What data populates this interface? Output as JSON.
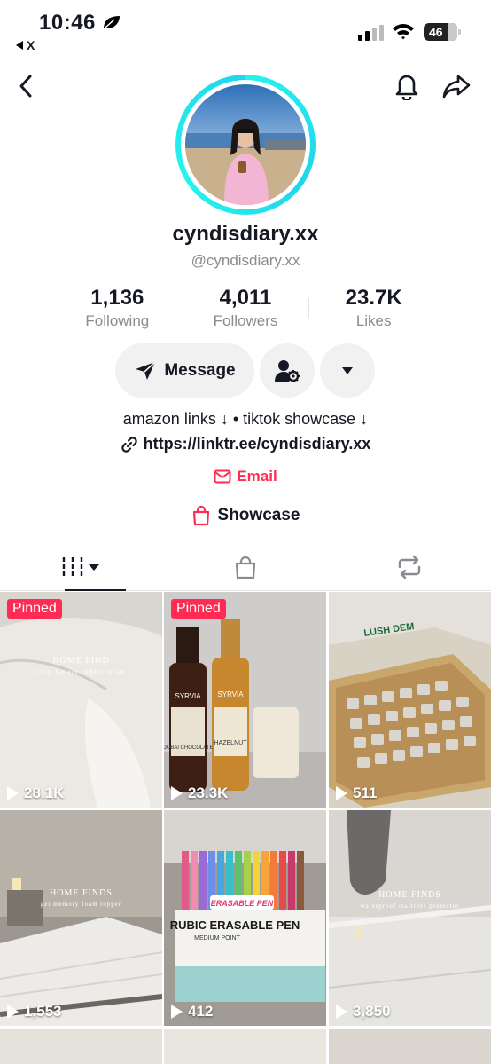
{
  "status_bar": {
    "time": "10:46",
    "back_app": "X",
    "battery": "46"
  },
  "profile": {
    "display_name": "cyndisdiary.xx",
    "handle": "@cyndisdiary.xx",
    "stats": [
      {
        "value": "1,136",
        "label": "Following"
      },
      {
        "value": "4,011",
        "label": "Followers"
      },
      {
        "value": "23.7K",
        "label": "Likes"
      }
    ],
    "message_label": "Message",
    "bio": "amazon links ↓ • tiktok showcase ↓",
    "link": "https://linktr.ee/cyndisdiary.xx",
    "email_label": "Email",
    "showcase_label": "Showcase"
  },
  "colors": {
    "accent": "#fe2c55",
    "ring": "#25f4ee",
    "button_bg": "#f1f1f2",
    "muted": "#8a8b91"
  },
  "videos": [
    {
      "pinned": "Pinned",
      "views": "28.1K",
      "overlay_title": "HOME FIND",
      "overlay_sub": "cozy 3-piece comforter set"
    },
    {
      "pinned": "Pinned",
      "views": "23.3K",
      "overlay_title": "",
      "overlay_sub": ""
    },
    {
      "pinned": "",
      "views": "511",
      "overlay_title": "",
      "overlay_sub": ""
    },
    {
      "pinned": "",
      "views": "1,553",
      "overlay_title": "HOME FINDS",
      "overlay_sub": "gel memory foam topper"
    },
    {
      "pinned": "",
      "views": "412",
      "overlay_title": "",
      "overlay_sub": ""
    },
    {
      "pinned": "",
      "views": "3,850",
      "overlay_title": "HOME FINDS",
      "overlay_sub": "waterproof mattress protector"
    }
  ],
  "product_labels": {
    "syrup_left": "DUBAI CHOCOLATE",
    "syrup_right": "HAZELNUT",
    "brand": "SYRVIA",
    "pen_box": "RUBIC ERASABLE PEN",
    "pen_sub": "MEDIUM POINT",
    "pen_tag": "ERASABLE PEN",
    "seed_brand": "LUSH DEM"
  }
}
